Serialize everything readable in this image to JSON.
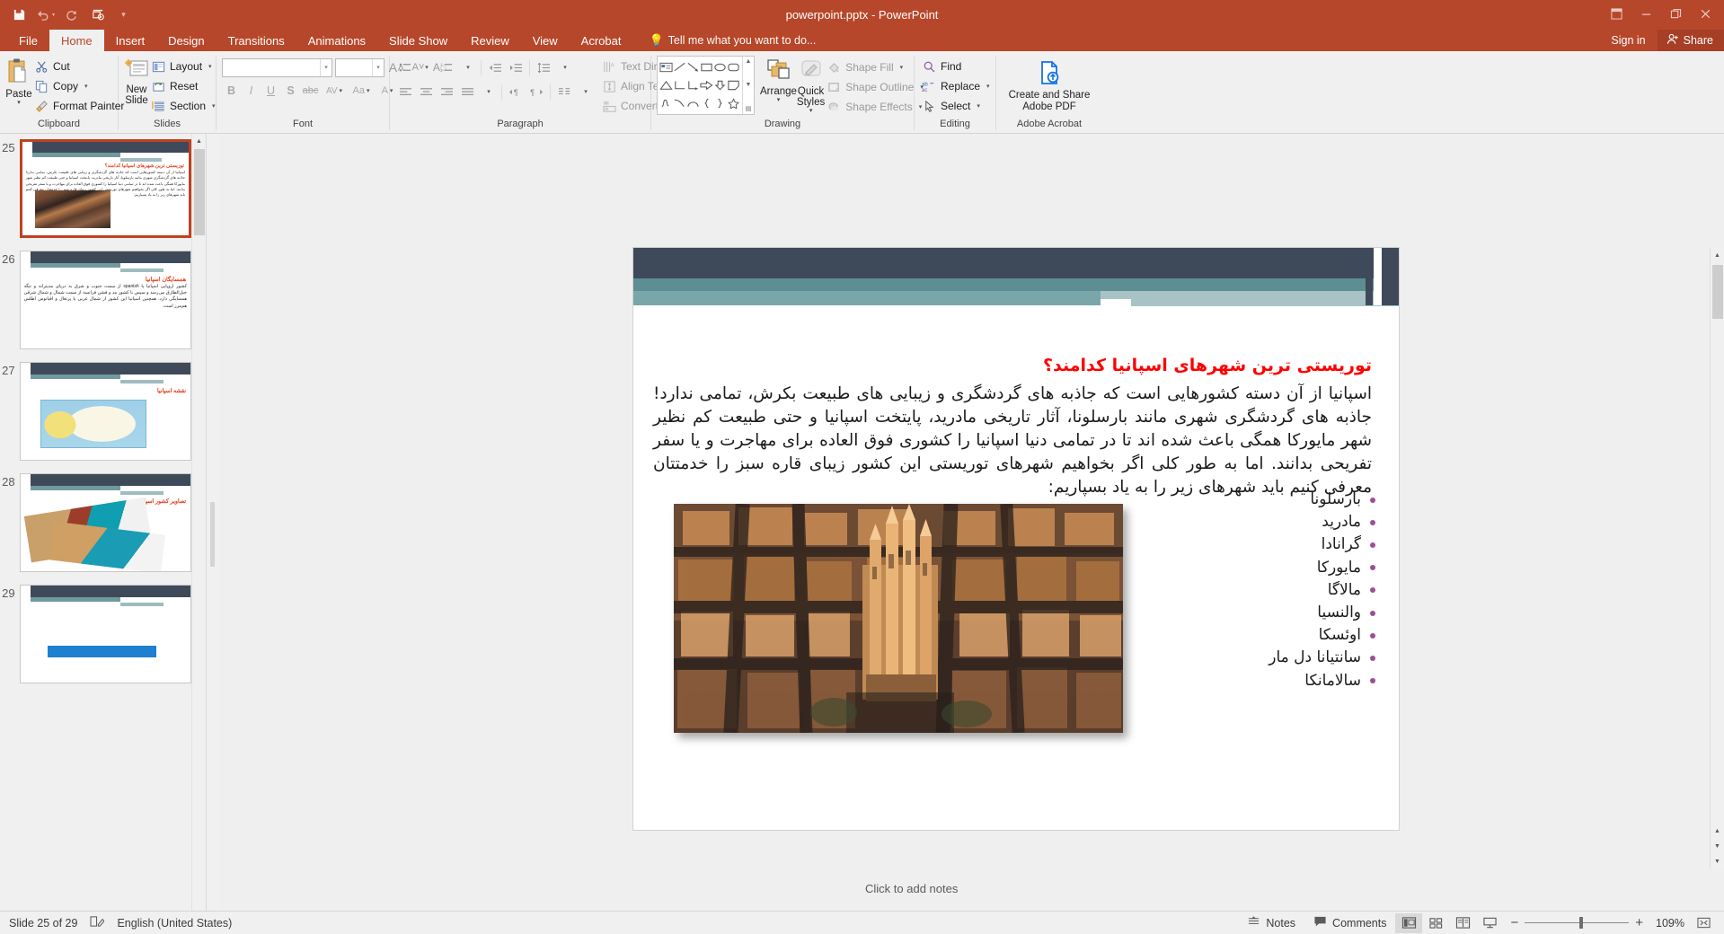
{
  "window": {
    "title": "powerpoint.pptx - PowerPoint",
    "quick_access": [
      "save-icon",
      "undo-icon",
      "redo-icon",
      "start-from-beginning-icon",
      "customize-qat-icon"
    ],
    "controls": [
      "ribbon-display-options",
      "minimize",
      "restore",
      "close"
    ],
    "sign_in": "Sign in",
    "share": "Share"
  },
  "ribbon": {
    "tabs": [
      {
        "label": "File",
        "active": false
      },
      {
        "label": "Home",
        "active": true
      },
      {
        "label": "Insert",
        "active": false
      },
      {
        "label": "Design",
        "active": false
      },
      {
        "label": "Transitions",
        "active": false
      },
      {
        "label": "Animations",
        "active": false
      },
      {
        "label": "Slide Show",
        "active": false
      },
      {
        "label": "Review",
        "active": false
      },
      {
        "label": "View",
        "active": false
      },
      {
        "label": "Acrobat",
        "active": false
      }
    ],
    "tell_me": "Tell me what you want to do...",
    "groups": [
      {
        "name": "Clipboard",
        "label": "Clipboard"
      },
      {
        "name": "Slides",
        "label": "Slides"
      },
      {
        "name": "Font",
        "label": "Font"
      },
      {
        "name": "Paragraph",
        "label": "Paragraph"
      },
      {
        "name": "Drawing",
        "label": "Drawing"
      },
      {
        "name": "Editing",
        "label": "Editing"
      },
      {
        "name": "Adobe Acrobat",
        "label": "Adobe Acrobat"
      }
    ],
    "clipboard": {
      "paste": "Paste",
      "cut": "Cut",
      "copy": "Copy",
      "format_painter": "Format Painter"
    },
    "slides": {
      "new_slide": "New Slide",
      "layout": "Layout",
      "reset": "Reset",
      "section": "Section"
    },
    "font": {
      "font_name": "",
      "font_size": "",
      "bold": "B",
      "italic": "I",
      "underline": "U",
      "shadow": "S",
      "strikethrough": "abc",
      "char_spacing": "AV",
      "change_case": "Aa",
      "grow_font": "A",
      "shrink_font": "A",
      "clear_formatting": "A"
    },
    "paragraph": {
      "text_direction": "Text Direction",
      "align_text": "Align Text",
      "convert_to_smartart": "Convert to SmartArt"
    },
    "drawing": {
      "arrange": "Arrange",
      "quick_styles": "Quick Styles",
      "shape_fill": "Shape Fill",
      "shape_outline": "Shape Outline",
      "shape_effects": "Shape Effects"
    },
    "editing": {
      "find": "Find",
      "replace": "Replace",
      "select": "Select"
    },
    "acrobat": {
      "create_and_share": "Create and Share",
      "adobe_pdf": "Adobe PDF"
    }
  },
  "thumbnails": [
    {
      "number": "25",
      "selected": true,
      "title": "توریستی ترین شهرهای اسپانیا کدامند؟",
      "body": "اسپانیا از آن دسته کشورهایی است که جاذبه های گردشگری و زیبایی های طبیعت بکرش، تمامی ندارد! جاذبه های گردشگری شهری مانند بارسلونا، آثار تاریخی مادرید، پایتخت اسپانیا و حتی طبیعت کم نظیر شهر مایورکا همگی باعث شده اند تا در تمامی دنیا اسپانیا را کشوری فوق العاده برای مهاجرت و یا سفر تفریحی بدانند. اما به طور کلی اگر بخواهیم شهرهای توریستی این کشور زیبای قاره سبز را خدمتتان معرفی کنیم باید شهرهای زیر را به یاد بسپاریم:",
      "picture": "barcelona-aerial-photo"
    },
    {
      "number": "26",
      "selected": false,
      "title": "همسایگان اسپانیا",
      "body": "کشور اروپایی اسپانیا یا spanish از سمت جنوب و شرق به دریای مدیترانه و تنگه جبل‌الطارق می‌رسد و سپس با کشور مد و فشن فرانسه از سمت شمال و شمال شرقی همسایگی دارد. همچنین اسپانیا این کشور از شمال غربی با پرتغال و اقیانوس اطلس هم‌مرز است.",
      "picture": null
    },
    {
      "number": "27",
      "selected": false,
      "title": "نقشه اسپانیا",
      "body": "",
      "picture": "spain-map"
    },
    {
      "number": "28",
      "selected": false,
      "title": "تصاویر کشور اسپانیا",
      "body": "",
      "picture": "spain-photo-collage"
    },
    {
      "number": "29",
      "selected": false,
      "title": "",
      "body": "",
      "picture": "blue-banner"
    }
  ],
  "slide": {
    "title": "توریستی ترین شهرهای اسپانیا کدامند؟",
    "title_color": "#ff0000",
    "body": "اسپانیا از آن دسته کشورهایی است که جاذبه های گردشگری و زیبایی های طبیعت بکرش، تمامی ندارد! جاذبه های گردشگری شهری مانند بارسلونا، آثار تاریخی مادرید، پایتخت اسپانیا و حتی طبیعت کم نظیر شهر مایورکا همگی باعث شده اند تا در تمامی دنیا اسپانیا را کشوری فوق العاده برای مهاجرت و یا سفر تفریحی بدانند. اما به طور کلی اگر بخواهیم شهرهای توریستی این کشور زیبای قاره سبز را خدمتتان معرفی کنیم باید شهرهای زیر را به یاد بسپاریم:",
    "bullet_color": "#9b4f96",
    "cities": [
      "بارسلونا",
      "مادرید",
      "گرانادا",
      "مایورکا",
      "مالاگا",
      "والنسیا",
      "اوئسکا",
      "سانتیانا دل مار",
      "سالامانکا"
    ],
    "picture_caption": "barcelona-sagrada-familia-aerial"
  },
  "notes": {
    "placeholder": "Click to add notes"
  },
  "status": {
    "slide_indicator": "Slide 25 of 29",
    "language": "English (United States)",
    "notes_button": "Notes",
    "comments_button": "Comments",
    "zoom_level": "109%",
    "views": [
      "normal-view",
      "slide-sorter-view",
      "reading-view",
      "slide-show-view"
    ]
  }
}
